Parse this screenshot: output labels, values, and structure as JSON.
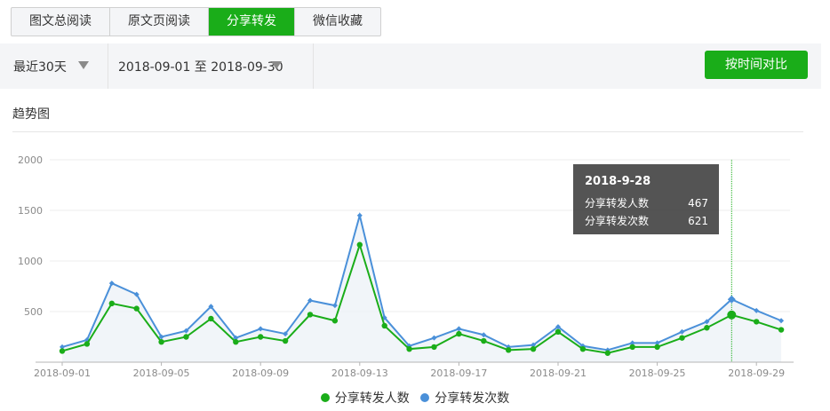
{
  "tabs": [
    {
      "label": "图文总阅读",
      "active": false
    },
    {
      "label": "原文页阅读",
      "active": false
    },
    {
      "label": "分享转发",
      "active": true
    },
    {
      "label": "微信收藏",
      "active": false
    }
  ],
  "filters": {
    "range_label": "最近30天",
    "date_range": "2018-09-01 至 2018-09-30"
  },
  "compare_button": "按时间对比",
  "section_title": "趋势图",
  "tooltip": {
    "date": "2018-9-28",
    "rows": [
      {
        "label": "分享转发人数",
        "value": "467"
      },
      {
        "label": "分享转发次数",
        "value": "621"
      }
    ]
  },
  "colors": {
    "accent": "#1aad19",
    "series_people": "#1aad19",
    "series_times": "#4a90d9"
  },
  "chart_data": {
    "type": "line",
    "x": [
      "2018-09-01",
      "2018-09-02",
      "2018-09-03",
      "2018-09-04",
      "2018-09-05",
      "2018-09-06",
      "2018-09-07",
      "2018-09-08",
      "2018-09-09",
      "2018-09-10",
      "2018-09-11",
      "2018-09-12",
      "2018-09-13",
      "2018-09-14",
      "2018-09-15",
      "2018-09-16",
      "2018-09-17",
      "2018-09-18",
      "2018-09-19",
      "2018-09-20",
      "2018-09-21",
      "2018-09-22",
      "2018-09-23",
      "2018-09-24",
      "2018-09-25",
      "2018-09-26",
      "2018-09-27",
      "2018-09-28",
      "2018-09-29",
      "2018-09-30"
    ],
    "x_tick_labels": [
      "2018-09-01",
      "2018-09-05",
      "2018-09-09",
      "2018-09-13",
      "2018-09-17",
      "2018-09-21",
      "2018-09-25",
      "2018-09-29"
    ],
    "series": [
      {
        "name": "分享转发人数",
        "values": [
          110,
          180,
          580,
          530,
          200,
          250,
          430,
          200,
          250,
          210,
          470,
          410,
          1160,
          360,
          130,
          150,
          280,
          210,
          120,
          130,
          300,
          130,
          90,
          150,
          150,
          240,
          340,
          467,
          400,
          320
        ]
      },
      {
        "name": "分享转发次数",
        "values": [
          150,
          220,
          780,
          670,
          250,
          310,
          550,
          240,
          330,
          280,
          610,
          560,
          1450,
          440,
          160,
          240,
          330,
          270,
          150,
          170,
          350,
          160,
          120,
          190,
          190,
          300,
          400,
          621,
          510,
          410
        ]
      }
    ],
    "ylim": [
      0,
      2000
    ],
    "y_ticks": [
      500,
      1000,
      1500,
      2000
    ],
    "highlight_index": 27,
    "grid": true,
    "legend": "bottom-center"
  }
}
